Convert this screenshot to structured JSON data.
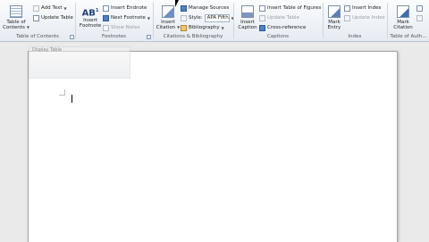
{
  "ribbon": {
    "toc": {
      "big_label": "Table of Contents",
      "add_text": "Add Text",
      "update_table": "Update Table",
      "group_label": "Table of Contents"
    },
    "footnotes": {
      "insert_footnote": "Insert Footnote",
      "ab_glyph": "AB",
      "superscript": "1",
      "insert_endnote": "Insert Endnote",
      "next_footnote": "Next Footnote",
      "show_notes": "Show Notes",
      "group_label": "Footnotes"
    },
    "citations": {
      "insert_citation": "Insert Citation",
      "manage_sources": "Manage Sources",
      "style_label": "Style:",
      "style_value": "APA Fifth",
      "bibliography": "Bibliography",
      "group_label": "Citations & Bibliography"
    },
    "captions": {
      "insert_caption": "Insert Caption",
      "insert_table_of_figures": "Insert Table of Figures",
      "update_table": "Update Table",
      "cross_reference": "Cross-reference",
      "group_label": "Captions"
    },
    "index": {
      "mark_entry": "Mark Entry",
      "insert_index": "Insert Index",
      "update_index": "Update Index",
      "group_label": "Index"
    },
    "toa": {
      "mark_citation": "Mark Citation",
      "group_label": "Table of Auth..."
    }
  },
  "document": {
    "ghost_label": "Display Table"
  },
  "icons": {
    "toc": "table-of-contents-icon",
    "footnote": "insert-footnote-icon",
    "citation": "insert-citation-icon",
    "caption": "insert-caption-icon",
    "mark_entry": "mark-entry-icon",
    "mark_citation": "mark-citation-icon"
  }
}
